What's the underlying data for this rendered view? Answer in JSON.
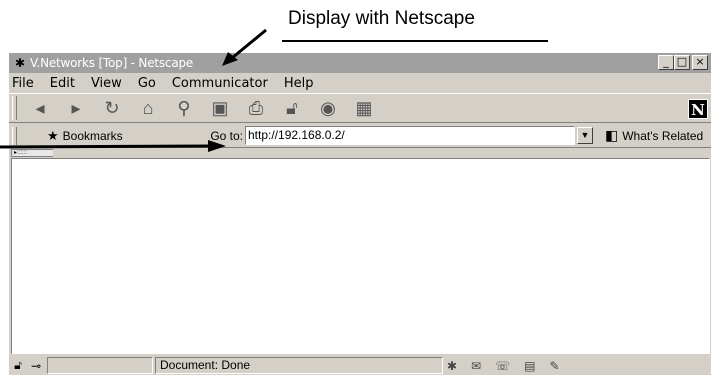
{
  "caption": "Display with Netscape",
  "window": {
    "title": "V.Networks [Top] - Netscape",
    "controls": [
      "_",
      "□",
      "×"
    ]
  },
  "menu": [
    "File",
    "Edit",
    "View",
    "Go",
    "Communicator",
    "Help"
  ],
  "toolbar": {
    "icons": [
      "back-icon",
      "forward-icon",
      "reload-icon",
      "home-icon",
      "search-icon",
      "my-netscape-icon",
      "print-icon",
      "security-icon",
      "shop-icon",
      "stop-icon"
    ],
    "logo": "N"
  },
  "location": {
    "bookmarks": "Bookmarks",
    "label": "Go to:",
    "url": "http://192.168.0.2/",
    "related": "What's Related"
  },
  "status": {
    "text": "Document: Done"
  }
}
